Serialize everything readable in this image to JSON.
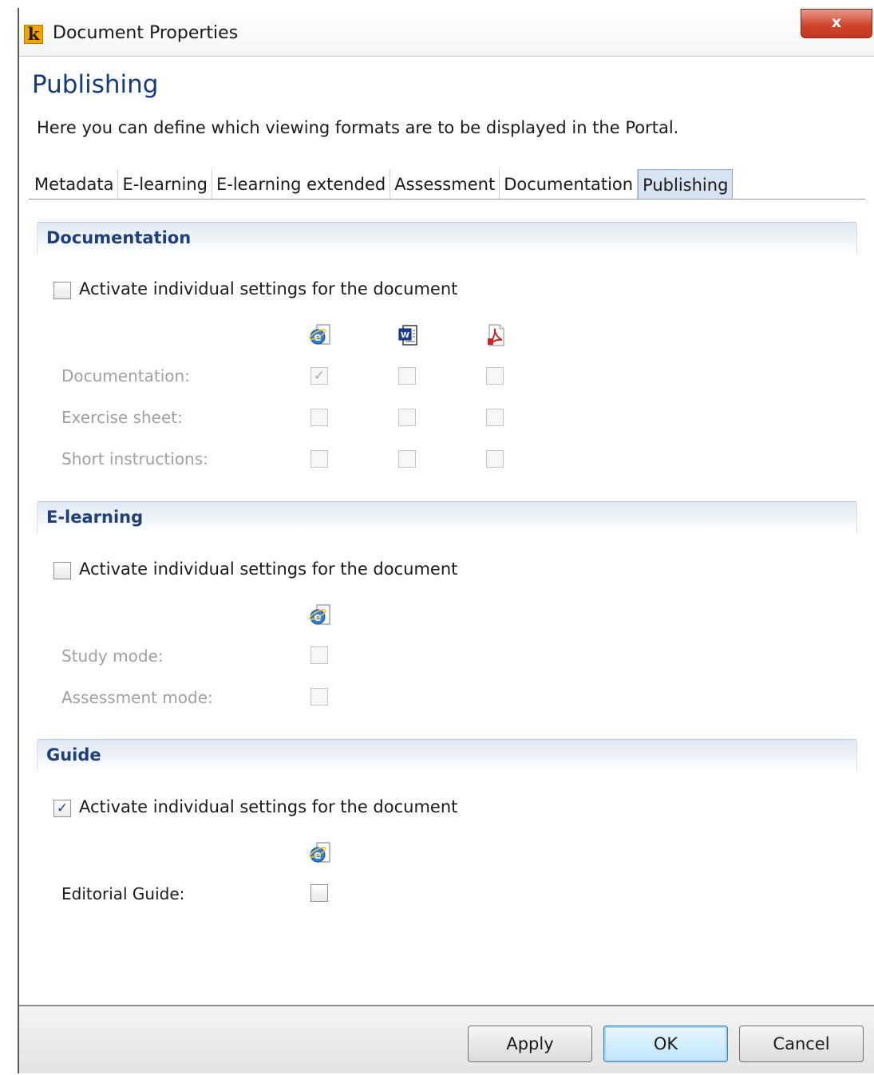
{
  "window": {
    "logo_letter": "k",
    "title": "Document Properties",
    "close_glyph": "x"
  },
  "header": {
    "title": "Publishing",
    "description": "Here you can define which viewing formats are to be displayed in the Portal."
  },
  "tabs": [
    {
      "label": "Metadata",
      "active": false
    },
    {
      "label": "E-learning",
      "active": false
    },
    {
      "label": "E-learning extended",
      "active": false
    },
    {
      "label": "Assessment",
      "active": false
    },
    {
      "label": "Documentation",
      "active": false
    },
    {
      "label": "Publishing",
      "active": true
    }
  ],
  "icons": {
    "html": "internet-explorer-icon",
    "word": "word-document-icon",
    "pdf": "pdf-document-icon"
  },
  "sections": {
    "documentation": {
      "title": "Documentation",
      "activate_label": "Activate individual settings for the document",
      "activate_checked": false,
      "rows": [
        {
          "label": "Documentation:",
          "html": true,
          "word": false,
          "pdf": false
        },
        {
          "label": "Exercise sheet:",
          "html": false,
          "word": false,
          "pdf": false
        },
        {
          "label": "Short instructions:",
          "html": false,
          "word": false,
          "pdf": false
        }
      ]
    },
    "elearning": {
      "title": "E-learning",
      "activate_label": "Activate individual settings for the document",
      "activate_checked": false,
      "rows": [
        {
          "label": "Study mode:",
          "html": false
        },
        {
          "label": "Assessment mode:",
          "html": false
        }
      ]
    },
    "guide": {
      "title": "Guide",
      "activate_label": "Activate individual settings for the document",
      "activate_checked": true,
      "rows": [
        {
          "label": "Editorial Guide:",
          "html": false
        }
      ]
    }
  },
  "buttons": {
    "apply": "Apply",
    "ok": "OK",
    "cancel": "Cancel"
  },
  "colors": {
    "title_blue": "#143a7e",
    "section_title": "#1e3f7a",
    "active_tab": "#d7e3f2"
  }
}
